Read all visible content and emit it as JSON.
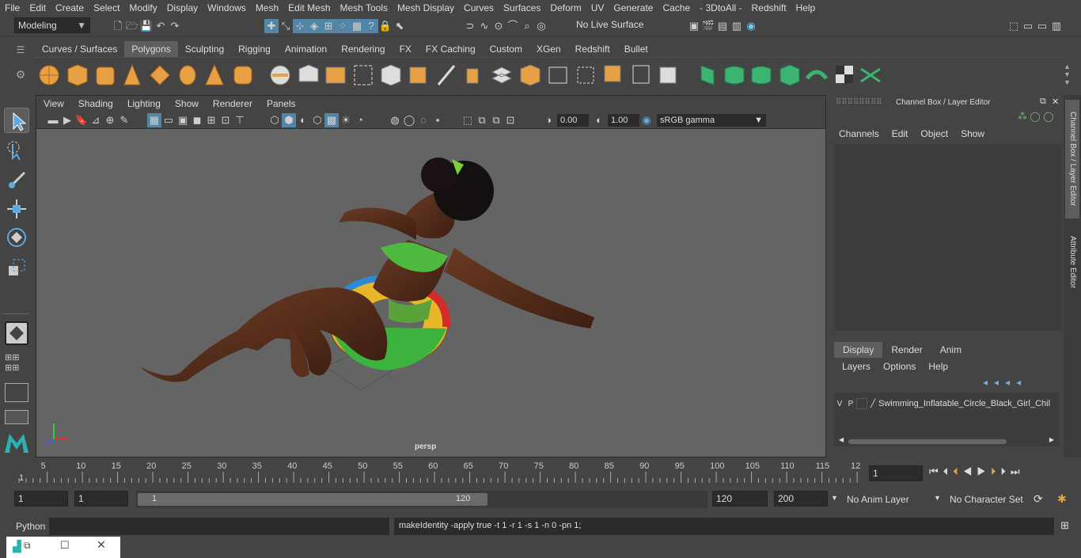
{
  "menu": [
    "File",
    "Edit",
    "Create",
    "Select",
    "Modify",
    "Display",
    "Windows",
    "Mesh",
    "Edit Mesh",
    "Mesh Tools",
    "Mesh Display",
    "Curves",
    "Surfaces",
    "Deform",
    "UV",
    "Generate",
    "Cache",
    "- 3DtoAll -",
    "Redshift",
    "Help"
  ],
  "status": {
    "mode": "Modeling",
    "live_surface": "No Live Surface"
  },
  "shelf_tabs": [
    "Curves / Surfaces",
    "Polygons",
    "Sculpting",
    "Rigging",
    "Animation",
    "Rendering",
    "FX",
    "FX Caching",
    "Custom",
    "XGen",
    "Redshift",
    "Bullet"
  ],
  "active_shelf": "Polygons",
  "viewport": {
    "menu": [
      "View",
      "Shading",
      "Lighting",
      "Show",
      "Renderer",
      "Panels"
    ],
    "field1": "0.00",
    "field2": "1.00",
    "colorspace": "sRGB gamma",
    "camera": "persp"
  },
  "channelbox": {
    "title": "Channel Box / Layer Editor",
    "menu": [
      "Channels",
      "Edit",
      "Object",
      "Show"
    ],
    "tabs": [
      "Display",
      "Render",
      "Anim"
    ],
    "active_tab": "Display",
    "layer_menu": [
      "Layers",
      "Options",
      "Help"
    ],
    "layer": {
      "v": "V",
      "p": "P",
      "name": "Swimming_Inflatable_Circle_Black_Girl_Chil"
    }
  },
  "sidetabs": [
    "Channel Box / Layer Editor",
    "Attribute Editor"
  ],
  "timeline": {
    "ticks": [
      "5",
      "10",
      "15",
      "20",
      "25",
      "30",
      "35",
      "40",
      "45",
      "50",
      "55",
      "60",
      "65",
      "70",
      "75",
      "80",
      "85",
      "90",
      "95",
      "100",
      "105",
      "110",
      "115",
      "12"
    ],
    "start_label": "1",
    "current_frame": "1"
  },
  "range": {
    "start": "1",
    "playback_start": "1",
    "slider_start": "1",
    "slider_end": "120",
    "playback_end": "120",
    "end": "200",
    "anim_layer": "No Anim Layer",
    "char_set": "No Character Set"
  },
  "cmdline": {
    "lang": "Python",
    "output": "makeIdentity -apply true -t 1 -r 1 -s 1 -n 0 -pn 1;"
  },
  "colors": {
    "bg": "#444444",
    "viewport": "#646464",
    "accent": "#5285a6",
    "shelf_orange": "#e8a045",
    "shelf_green": "#3cb371"
  }
}
